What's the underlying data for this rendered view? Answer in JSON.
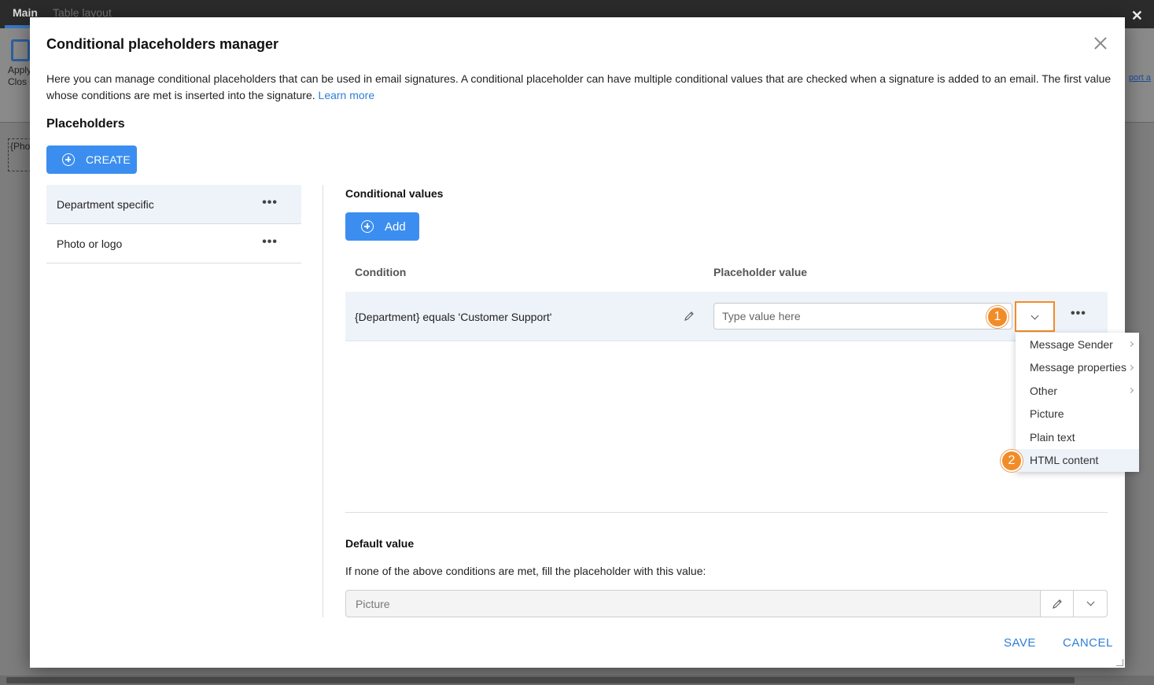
{
  "background": {
    "tabs": [
      "Main",
      "Table layout"
    ],
    "ribbon_button_label": "Apply\nClos",
    "link_partial": "port a",
    "placeholder_partial": "{Pho"
  },
  "dialog": {
    "title": "Conditional placeholders manager",
    "intro_text": "Here you can manage conditional placeholders that can be used in email signatures. A conditional placeholder can have multiple conditional values that are checked when a signature is added to an email. The first value whose conditions are met is inserted into the signature.",
    "learn_more": "Learn more",
    "placeholders_heading": "Placeholders",
    "create_label": "CREATE",
    "placeholders": [
      {
        "label": "Department specific",
        "active": true
      },
      {
        "label": "Photo or logo",
        "active": false
      }
    ],
    "more_glyph": "•••",
    "conditional_values": {
      "heading": "Conditional values",
      "add_label": "Add",
      "col_condition": "Condition",
      "col_value": "Placeholder value",
      "rows": [
        {
          "condition": "{Department} equals 'Customer Support'",
          "value_placeholder": "Type value here"
        }
      ]
    },
    "value_menu": {
      "items": [
        {
          "label": "Message Sender",
          "submenu": true
        },
        {
          "label": "Message properties",
          "submenu": true
        },
        {
          "label": "Other",
          "submenu": true
        },
        {
          "label": "Picture",
          "submenu": false
        },
        {
          "label": "Plain text",
          "submenu": false
        },
        {
          "label": "HTML content",
          "submenu": false,
          "highlighted": true
        }
      ]
    },
    "callouts": [
      "1",
      "2"
    ],
    "default_value": {
      "heading": "Default value",
      "description": "If none of the above conditions are met, fill the placeholder with this value:",
      "value": "Picture"
    },
    "save_label": "SAVE",
    "cancel_label": "CANCEL"
  },
  "colors": {
    "primary": "#3b8ef0",
    "callout": "#f28c28",
    "link": "#2f7fd6",
    "selected_row": "#eef3fa"
  }
}
